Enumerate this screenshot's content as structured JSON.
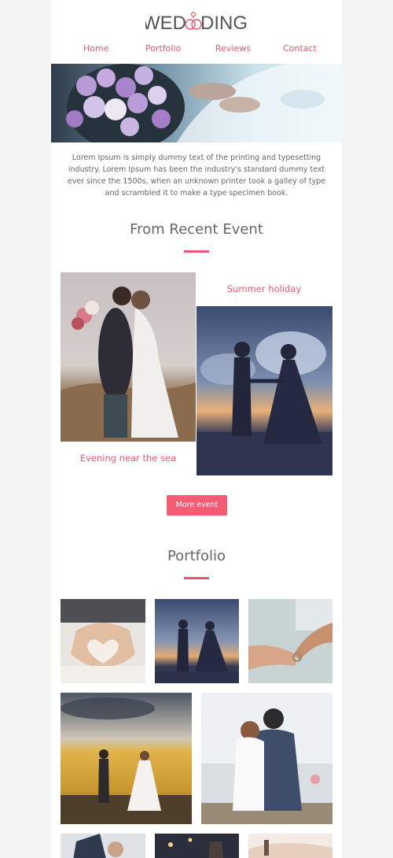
{
  "brand": {
    "left": "WED",
    "right": "DING"
  },
  "nav": {
    "items": [
      "Home",
      "Portfolio",
      "Reviews",
      "Contact"
    ]
  },
  "intro": {
    "text": "Lorem Ipsum is simply dummy text of the printing and typesetting industry. Lorem Ipsum has been the industry's standard dummy text ever since the 1500s, when an unknown printer took a galley of type and scrambled it to make a type specimen book."
  },
  "recent": {
    "title": "From Recent Event",
    "captions": [
      "Summer holiday",
      "Evening near the sea"
    ],
    "button": "More event"
  },
  "portfolio": {
    "title": "Portfolio"
  },
  "colors": {
    "accent": "#e8576f",
    "button": "#f25c75"
  }
}
